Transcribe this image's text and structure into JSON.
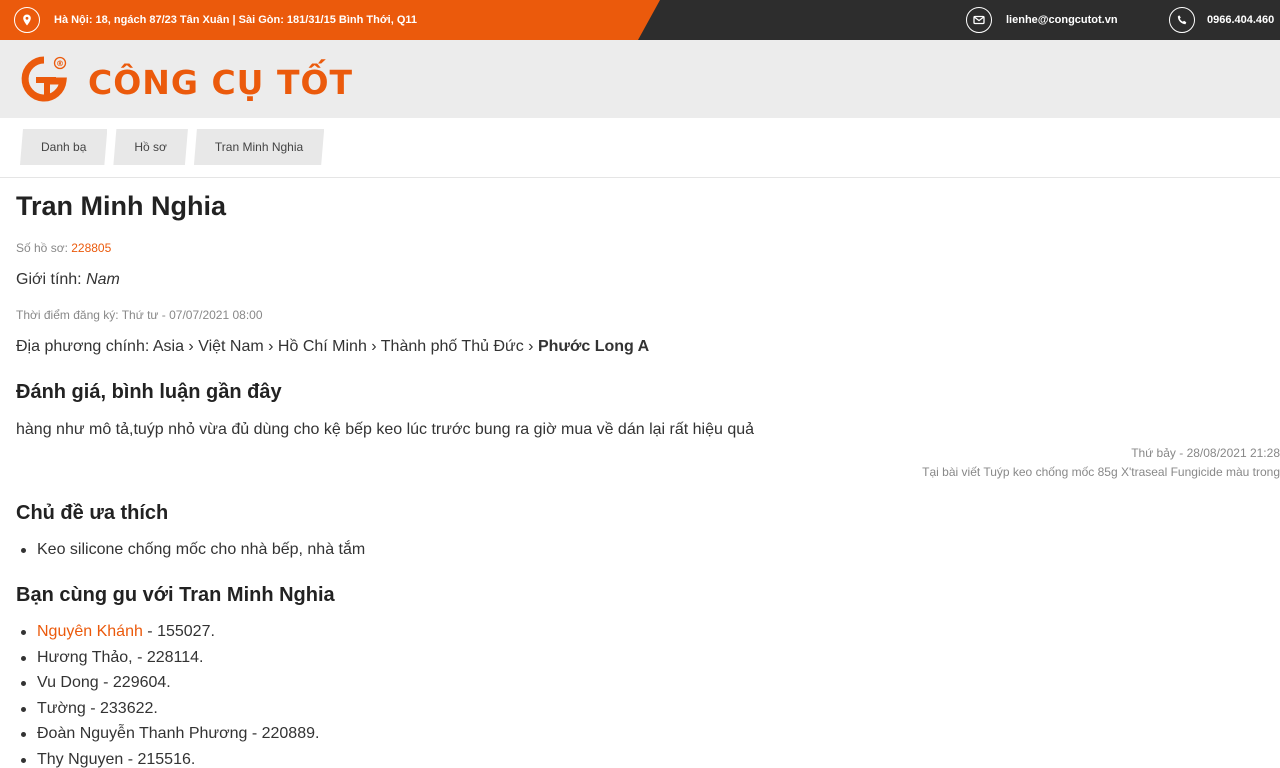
{
  "topbar": {
    "address": "Hà Nội: 18, ngách 87/23 Tân Xuân | Sài Gòn: 181/31/15 Bình Thới, Q11",
    "email": "lienhe@congcutot.vn",
    "phone": "0966.404.460",
    "colors": {
      "orange": "#eb5a0c",
      "dark": "#2d2d2d"
    }
  },
  "logo": {
    "text": "CÔNG CỤ TỐT",
    "registered": "®"
  },
  "breadcrumb": [
    {
      "label": "Danh bạ"
    },
    {
      "label": "Hồ sơ"
    },
    {
      "label": "Tran Minh Nghia"
    }
  ],
  "profile": {
    "name": "Tran Minh Nghia",
    "profile_no_label": "Số hồ sơ: ",
    "profile_no": "228805",
    "gender_label": "Giới tính: ",
    "gender": "Nam",
    "registered": "Thời điểm đăng ký: Thứ tư - 07/07/2021 08:00",
    "location_label": "Địa phương chính: ",
    "location_path": "Asia › Việt Nam › Hồ Chí Minh › Thành phố Thủ Đức › ",
    "location_last": "Phước Long A"
  },
  "reviews": {
    "heading": "Đánh giá, bình luận gần đây",
    "items": [
      {
        "text": "hàng như mô tả,tuýp nhỏ vừa đủ dùng cho kệ bếp keo lúc trước bung ra giờ mua về dán lại rất hiệu quả",
        "time": "Thứ bảy - 28/08/2021 21:28",
        "source": "Tại bài viết Tuýp keo chống mốc 85g X'traseal Fungicide màu trong"
      }
    ]
  },
  "topics": {
    "heading": "Chủ đề ưa thích",
    "items": [
      "Keo silicone chống mốc cho nhà bếp, nhà tắm"
    ]
  },
  "friends": {
    "heading": "Bạn cùng gu với Tran Minh Nghia",
    "items": [
      {
        "name": "Nguyên Khánh",
        "suffix": " - 155027.",
        "linked": true
      },
      {
        "name": "Hương Thảo,",
        "suffix": " - 228114.",
        "linked": false
      },
      {
        "name": "Vu Dong",
        "suffix": " - 229604.",
        "linked": false
      },
      {
        "name": "Tường",
        "suffix": " - 233622.",
        "linked": false
      },
      {
        "name": "Đoàn Nguyễn Thanh Phương",
        "suffix": " - 220889.",
        "linked": false
      },
      {
        "name": "Thy Nguyen",
        "suffix": " - 215516.",
        "linked": false
      }
    ]
  }
}
